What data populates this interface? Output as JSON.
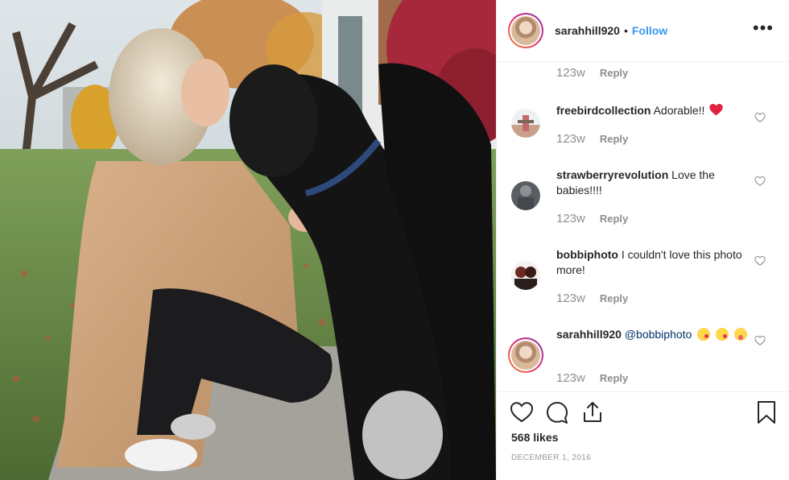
{
  "post": {
    "author": "sarahhill920",
    "separator": "•",
    "follow_label": "Follow",
    "more_label": "•••",
    "photo_alt_icon": "photo-woman-kissing-dog"
  },
  "comments": [
    {
      "username": "",
      "text": "",
      "time": "123w",
      "reply_label": "Reply"
    },
    {
      "username": "freebirdcollection",
      "text": "Adorable!!",
      "emoji": "red-heart",
      "time": "123w",
      "reply_label": "Reply"
    },
    {
      "username": "strawberryrevolution",
      "text": "Love the babies!!!!",
      "time": "123w",
      "reply_label": "Reply"
    },
    {
      "username": "bobbiphoto",
      "text": "I couldn't love this photo more!",
      "time": "123w",
      "reply_label": "Reply"
    },
    {
      "username": "sarahhill920",
      "mention": "@bobbiphoto",
      "emojis": [
        "kissing-face",
        "kissing-face",
        "winking-tongue-face"
      ],
      "time": "123w",
      "reply_label": "Reply"
    }
  ],
  "actions": {
    "likes": "568 likes",
    "date": "DECEMBER 1, 2016",
    "icons": [
      "heart-icon",
      "comment-icon",
      "share-icon",
      "bookmark-icon"
    ]
  },
  "colors": {
    "follow": "#3897f0",
    "secondary_text": "#8e8e8e",
    "border": "#efefef",
    "heart_emoji": "#ed4956"
  }
}
